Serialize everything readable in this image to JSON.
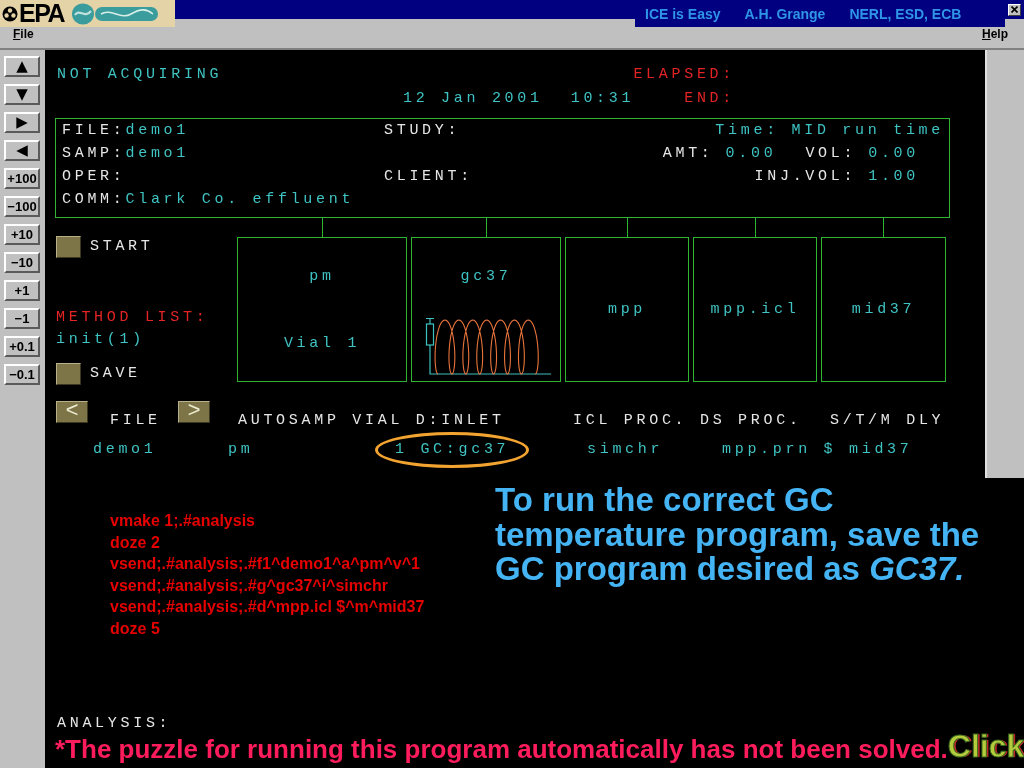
{
  "title_bar": {
    "logo_text": "EPA",
    "credits": [
      "ICE is Easy",
      "A.H. Grange",
      "NERL, ESD, ECB"
    ]
  },
  "menu": [
    "File",
    "Help"
  ],
  "side_buttons": [
    {
      "kind": "arrow",
      "label": "▲"
    },
    {
      "kind": "arrow",
      "label": "▼"
    },
    {
      "kind": "arrow",
      "label": "▶"
    },
    {
      "kind": "arrow",
      "label": "◀"
    },
    {
      "kind": "step",
      "label": "+100"
    },
    {
      "kind": "step",
      "label": "−100"
    },
    {
      "kind": "step",
      "label": "+10"
    },
    {
      "kind": "step",
      "label": "−10"
    },
    {
      "kind": "step",
      "label": "+1"
    },
    {
      "kind": "step",
      "label": "−1"
    },
    {
      "kind": "step",
      "label": "+0.1"
    },
    {
      "kind": "step",
      "label": "−0.1"
    }
  ],
  "status": {
    "state": "NOT ACQUIRING",
    "elapsed_label": "ELAPSED:",
    "date": "12 Jan 2001",
    "time": "10:31",
    "end_label": "END:"
  },
  "info_box": {
    "rows": [
      {
        "left": {
          "label": "FILE:",
          "value": "demo1"
        },
        "middle": {
          "label": "STUDY:"
        },
        "right": [
          {
            "value": "Time: MID run time"
          }
        ]
      },
      {
        "left": {
          "label": "SAMP:",
          "value": "demo1"
        },
        "right": [
          {
            "label": "AMT:",
            "value": "0.00"
          },
          {
            "label": "VOL:",
            "value": "0.00"
          }
        ]
      },
      {
        "left": {
          "label": "OPER:"
        },
        "middle": {
          "label": "CLIENT:"
        },
        "right": [
          {
            "label": "INJ.VOL:",
            "value": "1.00"
          }
        ]
      },
      {
        "left": {
          "label": "COMM:",
          "value": "Clark Co. effluent"
        }
      }
    ]
  },
  "start": {
    "label": "START"
  },
  "method_list": {
    "label": "METHOD LIST:",
    "items": [
      "init(1)"
    ]
  },
  "save": {
    "label": "SAVE"
  },
  "method_boxes": [
    {
      "kind": "vial",
      "name": "pm",
      "detail": "Vial 1"
    },
    {
      "kind": "oven",
      "name": "gc37"
    },
    {
      "kind": "plain",
      "name": "mpp"
    },
    {
      "kind": "plain",
      "name": "mpp.icl"
    },
    {
      "kind": "plain",
      "name": "mid37"
    }
  ],
  "sequence": {
    "prev": "<",
    "next": ">",
    "headers": [
      "FILE",
      "AUTOSAMP VIAL D:INLET",
      "ICL PROC. DS PROC.",
      "S/T/M DLY"
    ],
    "values": [
      {
        "text": "demo1",
        "circled": false
      },
      {
        "text": "pm",
        "circled": false
      },
      {
        "text": "1 GC:gc37",
        "circled": true
      },
      {
        "text": "simchr",
        "circled": false
      },
      {
        "text": "mpp.prn $ mid37",
        "circled": false
      }
    ]
  },
  "script_lines": [
    "vmake 1;.#analysis",
    "doze 2",
    "vsend;.#analysis;.#f1^demo1^a^pm^v^1",
    "vsend;.#analysis;.#g^gc37^i^simchr",
    "vsend;.#analysis;.#d^mpp.icl $^m^mid37",
    "doze 5"
  ],
  "note": "To run the correct GC temperature program, save the GC program desired as *GC37.*",
  "analysis_label": "ANALYSIS:",
  "footnote": "*The puzzle for running this program automatically has not been solved.",
  "click_label": "Click"
}
